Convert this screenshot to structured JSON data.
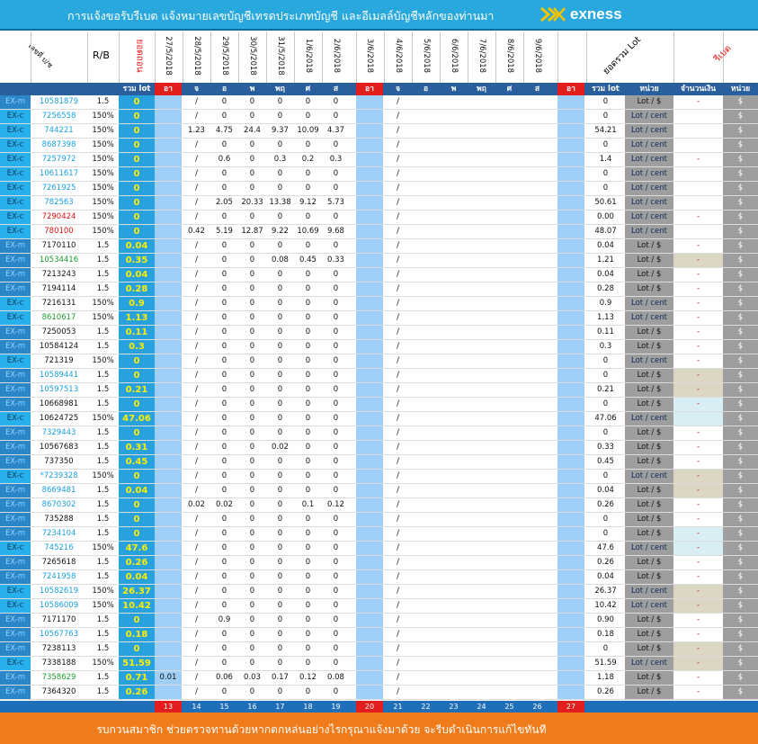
{
  "banner": {
    "title": "การแจ้งขอรับรีเบต  แจ้งหมายเลขบัญชีเทรดประเภทบัญชี  และอีเมลล์บัญชีหลักของท่านมา",
    "brand": "exness"
  },
  "header": {
    "account_label": "เลขที่ บ/ช",
    "rb_label": "R/B",
    "total_label": "ยอดรวม Lot",
    "rebate_label": "รีเบต",
    "fill_label": "ยอดถอน",
    "dates": [
      "27/5/2018",
      "28/5/2018",
      "29/5/2018",
      "30/5/2018",
      "31/5/2018",
      "1/6/2018",
      "2/6/2018",
      "3/6/2018",
      "4/6/2018",
      "5/6/2018",
      "6/6/2018",
      "7/6/2018",
      "8/6/2018",
      "9/6/2018"
    ]
  },
  "columns": {
    "total": "รวม lot",
    "days": [
      "อา",
      "จ",
      "อ",
      "พ",
      "พฤ",
      "ศ",
      "ส",
      "อา",
      "จ",
      "อ",
      "พ",
      "พฤ",
      "ศ",
      "ส",
      "อา"
    ],
    "sum": "รวม lot",
    "unit": "หน่วย",
    "amount": "จำนวนเงิน",
    "currency": "หน่วย"
  },
  "rows": [
    {
      "type": "EX-m",
      "acc": "10581879",
      "rb": "1.5",
      "tot": "0",
      "d0": "",
      "d1": "/",
      "w1": [
        "0",
        "0",
        "0",
        "0",
        "0"
      ],
      "sum": "0",
      "unit": "Lot / $",
      "amt": "-",
      "cur": "$",
      "accColor": "#1aa0dc",
      "bg": "white"
    },
    {
      "type": "EX-c",
      "acc": "7256558",
      "rb": "150%",
      "tot": "0",
      "d0": "",
      "d1": "/",
      "w1": [
        "0",
        "0",
        "0",
        "0",
        "0"
      ],
      "sum": "0",
      "unit": "Lot / cent",
      "amt": "",
      "cur": "$",
      "accColor": "#1aa0dc",
      "bg": "white"
    },
    {
      "type": "EX-c",
      "acc": "744221",
      "rb": "150%",
      "tot": "0",
      "d0": "",
      "d1": "1.23",
      "w1": [
        "4.75",
        "24.4",
        "9.37",
        "10.09",
        "4.37"
      ],
      "sum": "54.21",
      "unit": "Lot / cent",
      "amt": "",
      "cur": "$",
      "accColor": "#1aa0dc",
      "bg": "white"
    },
    {
      "type": "EX-c",
      "acc": "8687398",
      "rb": "150%",
      "tot": "0",
      "d0": "",
      "d1": "/",
      "w1": [
        "0",
        "0",
        "0",
        "0",
        "0"
      ],
      "sum": "0",
      "unit": "Lot / cent",
      "amt": "",
      "cur": "$",
      "accColor": "#1aa0dc",
      "bg": "white"
    },
    {
      "type": "EX-c",
      "acc": "7257972",
      "rb": "150%",
      "tot": "0",
      "d0": "",
      "d1": "/",
      "w1": [
        "0.6",
        "0",
        "0.3",
        "0.2",
        "0.3"
      ],
      "sum": "1.4",
      "unit": "Lot / cent",
      "amt": "-",
      "cur": "$",
      "accColor": "#1aa0dc",
      "bg": "white"
    },
    {
      "type": "EX-c",
      "acc": "10611617",
      "rb": "150%",
      "tot": "0",
      "d0": "",
      "d1": "/",
      "w1": [
        "0",
        "0",
        "0",
        "0",
        "0"
      ],
      "sum": "0",
      "unit": "Lot / cent",
      "amt": "",
      "cur": "$",
      "accColor": "#1aa0dc",
      "bg": "white"
    },
    {
      "type": "EX-c",
      "acc": "7261925",
      "rb": "150%",
      "tot": "0",
      "d0": "",
      "d1": "/",
      "w1": [
        "0",
        "0",
        "0",
        "0",
        "0"
      ],
      "sum": "0",
      "unit": "Lot / cent",
      "amt": "",
      "cur": "$",
      "accColor": "#1aa0dc",
      "bg": "white"
    },
    {
      "type": "EX-c",
      "acc": "782563",
      "rb": "150%",
      "tot": "0",
      "d0": "",
      "d1": "/",
      "w1": [
        "2.05",
        "20.33",
        "13.38",
        "9.12",
        "5.73"
      ],
      "sum": "50.61",
      "unit": "Lot / cent",
      "amt": "",
      "cur": "$",
      "accColor": "#1aa0dc",
      "bg": "white"
    },
    {
      "type": "EX-c",
      "acc": "7290424",
      "rb": "150%",
      "tot": "0",
      "d0": "",
      "d1": "/",
      "w1": [
        "0",
        "0",
        "0",
        "0",
        "0"
      ],
      "sum": "0.00",
      "unit": "Lot / cent",
      "amt": "-",
      "cur": "$",
      "accColor": "#e01010",
      "bg": "white"
    },
    {
      "type": "EX-c",
      "acc": "780100",
      "rb": "150%",
      "tot": "0",
      "d0": "",
      "d1": "0.42",
      "w1": [
        "5.19",
        "12.87",
        "9.22",
        "10.69",
        "9.68"
      ],
      "sum": "48.07",
      "unit": "Lot / cent",
      "amt": "",
      "cur": "$",
      "accColor": "#e01010",
      "bg": "white"
    },
    {
      "type": "EX-m",
      "acc": "7170110",
      "rb": "1.5",
      "tot": "0.04",
      "d0": "",
      "d1": "/",
      "w1": [
        "0",
        "0",
        "0",
        "0",
        "0"
      ],
      "sum": "0.04",
      "unit": "Lot / $",
      "amt": "-",
      "cur": "$",
      "accColor": "#111111",
      "bg": "white"
    },
    {
      "type": "EX-m",
      "acc": "10534416",
      "rb": "1.5",
      "tot": "0.35",
      "d0": "",
      "d1": "/",
      "w1": [
        "0",
        "0",
        "0.08",
        "0.45",
        "0.33"
      ],
      "sum": "1.21",
      "unit": "Lot / $",
      "amt": "-",
      "cur": "$",
      "accColor": "#1a9c2b",
      "bg": "beige"
    },
    {
      "type": "EX-m",
      "acc": "7213243",
      "rb": "1.5",
      "tot": "0.04",
      "d0": "",
      "d1": "/",
      "w1": [
        "0",
        "0",
        "0",
        "0",
        "0"
      ],
      "sum": "0.04",
      "unit": "Lot / $",
      "amt": "-",
      "cur": "$",
      "accColor": "#111111",
      "bg": "white"
    },
    {
      "type": "EX-m",
      "acc": "7194114",
      "rb": "1.5",
      "tot": "0.28",
      "d0": "",
      "d1": "/",
      "w1": [
        "0",
        "0",
        "0",
        "0",
        "0"
      ],
      "sum": "0.28",
      "unit": "Lot / $",
      "amt": "-",
      "cur": "$",
      "accColor": "#111111",
      "bg": "white"
    },
    {
      "type": "EX-c",
      "acc": "7216131",
      "rb": "150%",
      "tot": "0.9",
      "d0": "",
      "d1": "/",
      "w1": [
        "0",
        "0",
        "0",
        "0",
        "0"
      ],
      "sum": "0.9",
      "unit": "Lot / cent",
      "amt": "-",
      "cur": "$",
      "accColor": "#111111",
      "bg": "white"
    },
    {
      "type": "EX-c",
      "acc": "8610617",
      "rb": "150%",
      "tot": "1.13",
      "d0": "",
      "d1": "/",
      "w1": [
        "0",
        "0",
        "0",
        "0",
        "0"
      ],
      "sum": "1.13",
      "unit": "Lot / cent",
      "amt": "-",
      "cur": "$",
      "accColor": "#1a9c2b",
      "bg": "white"
    },
    {
      "type": "EX-m",
      "acc": "7250053",
      "rb": "1.5",
      "tot": "0.11",
      "d0": "",
      "d1": "/",
      "w1": [
        "0",
        "0",
        "0",
        "0",
        "0"
      ],
      "sum": "0.11",
      "unit": "Lot / $",
      "amt": "-",
      "cur": "$",
      "accColor": "#111111",
      "bg": "white"
    },
    {
      "type": "EX-m",
      "acc": "10584124",
      "rb": "1.5",
      "tot": "0.3",
      "d0": "",
      "d1": "/",
      "w1": [
        "0",
        "0",
        "0",
        "0",
        "0"
      ],
      "sum": "0.3",
      "unit": "Lot / $",
      "amt": "-",
      "cur": "$",
      "accColor": "#111111",
      "bg": "white"
    },
    {
      "type": "EX-c",
      "acc": "721319",
      "rb": "150%",
      "tot": "0",
      "d0": "",
      "d1": "/",
      "w1": [
        "0",
        "0",
        "0",
        "0",
        "0"
      ],
      "sum": "0",
      "unit": "Lot / cent",
      "amt": "-",
      "cur": "$",
      "accColor": "#111111",
      "bg": "white"
    },
    {
      "type": "EX-m",
      "acc": "10589441",
      "rb": "1.5",
      "tot": "0",
      "d0": "",
      "d1": "/",
      "w1": [
        "0",
        "0",
        "0",
        "0",
        "0"
      ],
      "sum": "0",
      "unit": "Lot / $",
      "amt": "-",
      "cur": "$",
      "accColor": "#1aa0dc",
      "bg": "beige"
    },
    {
      "type": "EX-m",
      "acc": "10597513",
      "rb": "1.5",
      "tot": "0.21",
      "d0": "",
      "d1": "/",
      "w1": [
        "0",
        "0",
        "0",
        "0",
        "0"
      ],
      "sum": "0.21",
      "unit": "Lot / $",
      "amt": "-",
      "cur": "$",
      "accColor": "#1aa0dc",
      "bg": "beige"
    },
    {
      "type": "EX-m",
      "acc": "10668981",
      "rb": "1.5",
      "tot": "0",
      "d0": "",
      "d1": "/",
      "w1": [
        "0",
        "0",
        "0",
        "0",
        "0"
      ],
      "sum": "0",
      "unit": "Lot / $",
      "amt": "-",
      "cur": "$",
      "accColor": "#111111",
      "bg": "ice"
    },
    {
      "type": "EX-c",
      "acc": "10624725",
      "rb": "150%",
      "tot": "47.06",
      "d0": "",
      "d1": "/",
      "w1": [
        "0",
        "0",
        "0",
        "0",
        "0"
      ],
      "sum": "47.06",
      "unit": "Lot / cent",
      "amt": "",
      "cur": "$",
      "accColor": "#111111",
      "bg": "ice"
    },
    {
      "type": "EX-m",
      "acc": "7329443",
      "rb": "1.5",
      "tot": "0",
      "d0": "",
      "d1": "/",
      "w1": [
        "0",
        "0",
        "0",
        "0",
        "0"
      ],
      "sum": "0",
      "unit": "Lot / $",
      "amt": "-",
      "cur": "$",
      "accColor": "#1aa0dc",
      "bg": "white"
    },
    {
      "type": "EX-m",
      "acc": "10567683",
      "rb": "1.5",
      "tot": "0.31",
      "d0": "",
      "d1": "/",
      "w1": [
        "0",
        "0",
        "0.02",
        "0",
        "0"
      ],
      "sum": "0.33",
      "unit": "Lot / $",
      "amt": "-",
      "cur": "$",
      "accColor": "#111111",
      "bg": "white"
    },
    {
      "type": "EX-m",
      "acc": "737350",
      "rb": "1.5",
      "tot": "0.45",
      "d0": "",
      "d1": "/",
      "w1": [
        "0",
        "0",
        "0",
        "0",
        "0"
      ],
      "sum": "0.45",
      "unit": "Lot / $",
      "amt": "-",
      "cur": "$",
      "accColor": "#111111",
      "bg": "white"
    },
    {
      "type": "EX-c",
      "acc": "*7239328",
      "rb": "150%",
      "tot": "0",
      "d0": "",
      "d1": "/",
      "w1": [
        "0",
        "0",
        "0",
        "0",
        "0"
      ],
      "sum": "0",
      "unit": "Lot / cent",
      "amt": "-",
      "cur": "$",
      "accColor": "#1aa0dc",
      "bg": "beige"
    },
    {
      "type": "EX-m",
      "acc": "8669481",
      "rb": "1.5",
      "tot": "0.04",
      "d0": "",
      "d1": "/",
      "w1": [
        "0",
        "0",
        "0",
        "0",
        "0"
      ],
      "sum": "0.04",
      "unit": "Lot / $",
      "amt": "-",
      "cur": "$",
      "accColor": "#1aa0dc",
      "bg": "beige"
    },
    {
      "type": "EX-m",
      "acc": "8670302",
      "rb": "1.5",
      "tot": "0",
      "d0": "",
      "d1": "0.02",
      "w1": [
        "0.02",
        "0",
        "0",
        "0.1",
        "0.12"
      ],
      "sum": "0.26",
      "unit": "Lot / $",
      "amt": "-",
      "cur": "$",
      "accColor": "#1aa0dc",
      "bg": "white"
    },
    {
      "type": "EX-m",
      "acc": "735288",
      "rb": "1.5",
      "tot": "0",
      "d0": "",
      "d1": "/",
      "w1": [
        "0",
        "0",
        "0",
        "0",
        "0"
      ],
      "sum": "0",
      "unit": "Lot / $",
      "amt": "-",
      "cur": "$",
      "accColor": "#111111",
      "bg": "white"
    },
    {
      "type": "EX-m",
      "acc": "7234104",
      "rb": "1.5",
      "tot": "0",
      "d0": "",
      "d1": "/",
      "w1": [
        "0",
        "0",
        "0",
        "0",
        "0"
      ],
      "sum": "0",
      "unit": "Lot / $",
      "amt": "-",
      "cur": "$",
      "accColor": "#1aa0dc",
      "bg": "ice"
    },
    {
      "type": "EX-c",
      "acc": "745216",
      "rb": "150%",
      "tot": "47.6",
      "d0": "",
      "d1": "/",
      "w1": [
        "0",
        "0",
        "0",
        "0",
        "0"
      ],
      "sum": "47.6",
      "unit": "Lot / cent",
      "amt": "-",
      "cur": "$",
      "accColor": "#1aa0dc",
      "bg": "ice"
    },
    {
      "type": "EX-m",
      "acc": "7265618",
      "rb": "1.5",
      "tot": "0.26",
      "d0": "",
      "d1": "/",
      "w1": [
        "0",
        "0",
        "0",
        "0",
        "0"
      ],
      "sum": "0.26",
      "unit": "Lot / $",
      "amt": "-",
      "cur": "$",
      "accColor": "#111111",
      "bg": "white"
    },
    {
      "type": "EX-m",
      "acc": "7241958",
      "rb": "1.5",
      "tot": "0.04",
      "d0": "",
      "d1": "/",
      "w1": [
        "0",
        "0",
        "0",
        "0",
        "0"
      ],
      "sum": "0.04",
      "unit": "Lot / $",
      "amt": "-",
      "cur": "$",
      "accColor": "#1aa0dc",
      "bg": "white"
    },
    {
      "type": "EX-c",
      "acc": "10582619",
      "rb": "150%",
      "tot": "26.37",
      "d0": "",
      "d1": "/",
      "w1": [
        "0",
        "0",
        "0",
        "0",
        "0"
      ],
      "sum": "26.37",
      "unit": "Lot / cent",
      "amt": "-",
      "cur": "$",
      "accColor": "#1aa0dc",
      "bg": "beige"
    },
    {
      "type": "EX-c",
      "acc": "10586009",
      "rb": "150%",
      "tot": "10.42",
      "d0": "",
      "d1": "/",
      "w1": [
        "0",
        "0",
        "0",
        "0",
        "0"
      ],
      "sum": "10.42",
      "unit": "Lot / cent",
      "amt": "-",
      "cur": "$",
      "accColor": "#1aa0dc",
      "bg": "beige"
    },
    {
      "type": "EX-m",
      "acc": "7171170",
      "rb": "1.5",
      "tot": "0",
      "d0": "",
      "d1": "/",
      "w1": [
        "0.9",
        "0",
        "0",
        "0",
        "0"
      ],
      "sum": "0.90",
      "unit": "Lot / $",
      "amt": "-",
      "cur": "$",
      "accColor": "#111111",
      "bg": "white"
    },
    {
      "type": "EX-m",
      "acc": "10567763",
      "rb": "1.5",
      "tot": "0.18",
      "d0": "",
      "d1": "/",
      "w1": [
        "0",
        "0",
        "0",
        "0",
        "0"
      ],
      "sum": "0.18",
      "unit": "Lot / $",
      "amt": "-",
      "cur": "$",
      "accColor": "#1aa0dc",
      "bg": "white"
    },
    {
      "type": "EX-m",
      "acc": "7238113",
      "rb": "1.5",
      "tot": "0",
      "d0": "",
      "d1": "/",
      "w1": [
        "0",
        "0",
        "0",
        "0",
        "0"
      ],
      "sum": "0",
      "unit": "Lot / $",
      "amt": "-",
      "cur": "$",
      "accColor": "#111111",
      "bg": "beige"
    },
    {
      "type": "EX-c",
      "acc": "7338188",
      "rb": "150%",
      "tot": "51.59",
      "d0": "",
      "d1": "/",
      "w1": [
        "0",
        "0",
        "0",
        "0",
        "0"
      ],
      "sum": "51.59",
      "unit": "Lot / cent",
      "amt": "-",
      "cur": "$",
      "accColor": "#111111",
      "bg": "beige"
    },
    {
      "type": "EX-m",
      "acc": "7358629",
      "rb": "1.5",
      "tot": "0.71",
      "d0": "0.01",
      "d1": "/",
      "w1": [
        "0.06",
        "0.03",
        "0.17",
        "0.12",
        "0.08"
      ],
      "sum": "1.18",
      "unit": "Lot / $",
      "amt": "-",
      "cur": "$",
      "accColor": "#1a9c2b",
      "bg": "white"
    },
    {
      "type": "EX-m",
      "acc": "7364320",
      "rb": "1.5",
      "tot": "0.26",
      "d0": "",
      "d1": "/",
      "w1": [
        "0",
        "0",
        "0",
        "0",
        "0"
      ],
      "sum": "0.26",
      "unit": "Lot / $",
      "amt": "-",
      "cur": "$",
      "accColor": "#111111",
      "bg": "white"
    }
  ],
  "footer_days": [
    "13",
    "14",
    "15",
    "16",
    "17",
    "18",
    "19",
    "20",
    "21",
    "22",
    "23",
    "24",
    "25",
    "26",
    "27"
  ],
  "footer": {
    "text": "รบกวนสมาชิก ช่วยตรวจทานด้วยหากตกหล่นอย่างไรกรุณาแจ้งมาด้วย  จะรีบดำเนินการแก้ไขทันที"
  }
}
